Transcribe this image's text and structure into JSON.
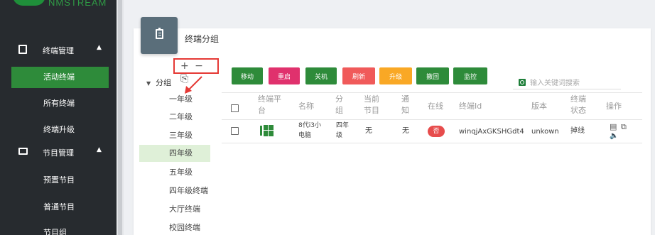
{
  "sidebar": {
    "logo_text": "NMSTREAM",
    "groups": [
      {
        "label": "终端管理",
        "icon": "clipboard-icon"
      },
      {
        "label": "节目管理",
        "icon": "monitor-icon"
      }
    ],
    "terminal_items": [
      {
        "label": "活动终端"
      },
      {
        "label": "所有终端"
      },
      {
        "label": "终端升级"
      }
    ],
    "program_items": [
      {
        "label": "预置节目"
      },
      {
        "label": "普通节目"
      },
      {
        "label": "节目组"
      }
    ]
  },
  "page": {
    "title": "终端分组",
    "icon": "clipboard-icon"
  },
  "tree": {
    "toolbar": "+ − ⎘",
    "root_label": "分组",
    "nodes": [
      "一年级",
      "二年级",
      "三年级",
      "四年级",
      "五年级",
      "四年级终端",
      "大厅终端",
      "校园终端"
    ],
    "selected": "四年级"
  },
  "actions": [
    {
      "label": "移动",
      "color": "#2e8b3a"
    },
    {
      "label": "重启",
      "color": "#e0316d"
    },
    {
      "label": "关机",
      "color": "#2e8b3a"
    },
    {
      "label": "刷新",
      "color": "#f05a5a"
    },
    {
      "label": "升级",
      "color": "#f9a825"
    },
    {
      "label": "撤回",
      "color": "#2e8b3a"
    },
    {
      "label": "监控",
      "color": "#2e8b3a"
    }
  ],
  "search": {
    "placeholder": "输入关键词搜索"
  },
  "table": {
    "headers": [
      "终端平台",
      "名称",
      "分组",
      "当前节目",
      "通知",
      "在线",
      "终端Id",
      "版本",
      "终端状态",
      "操作"
    ],
    "rows": [
      {
        "platform_icon": "windows-icon",
        "name": "8代i3小电脑",
        "group": "四年级",
        "program": "无",
        "notice": "无",
        "online": "否",
        "terminal_id": "winqjAxGKSHGdt4",
        "version": "unkown",
        "status": "掉线"
      }
    ]
  },
  "colors": {
    "sidebar_bg": "#272b2f",
    "accent_green": "#2e8b3a",
    "alert_red": "#e53935"
  }
}
